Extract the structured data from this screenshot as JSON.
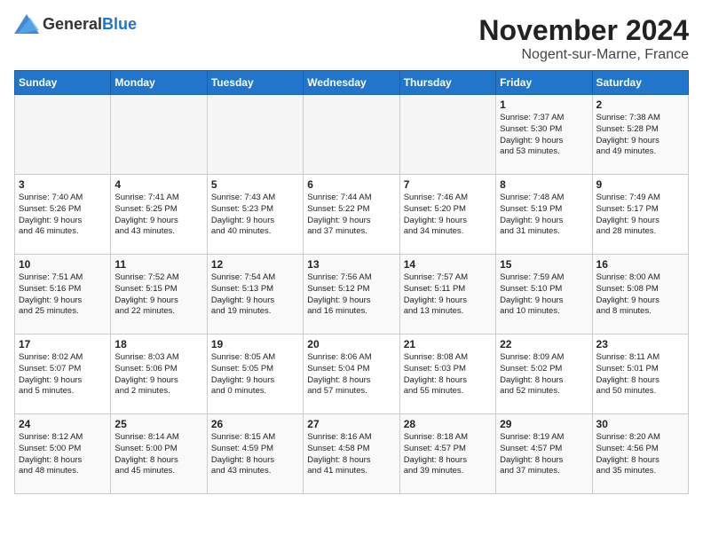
{
  "logo": {
    "text_general": "General",
    "text_blue": "Blue"
  },
  "title": {
    "month": "November 2024",
    "location": "Nogent-sur-Marne, France"
  },
  "headers": [
    "Sunday",
    "Monday",
    "Tuesday",
    "Wednesday",
    "Thursday",
    "Friday",
    "Saturday"
  ],
  "weeks": [
    [
      {
        "day": "",
        "info": ""
      },
      {
        "day": "",
        "info": ""
      },
      {
        "day": "",
        "info": ""
      },
      {
        "day": "",
        "info": ""
      },
      {
        "day": "",
        "info": ""
      },
      {
        "day": "1",
        "info": "Sunrise: 7:37 AM\nSunset: 5:30 PM\nDaylight: 9 hours\nand 53 minutes."
      },
      {
        "day": "2",
        "info": "Sunrise: 7:38 AM\nSunset: 5:28 PM\nDaylight: 9 hours\nand 49 minutes."
      }
    ],
    [
      {
        "day": "3",
        "info": "Sunrise: 7:40 AM\nSunset: 5:26 PM\nDaylight: 9 hours\nand 46 minutes."
      },
      {
        "day": "4",
        "info": "Sunrise: 7:41 AM\nSunset: 5:25 PM\nDaylight: 9 hours\nand 43 minutes."
      },
      {
        "day": "5",
        "info": "Sunrise: 7:43 AM\nSunset: 5:23 PM\nDaylight: 9 hours\nand 40 minutes."
      },
      {
        "day": "6",
        "info": "Sunrise: 7:44 AM\nSunset: 5:22 PM\nDaylight: 9 hours\nand 37 minutes."
      },
      {
        "day": "7",
        "info": "Sunrise: 7:46 AM\nSunset: 5:20 PM\nDaylight: 9 hours\nand 34 minutes."
      },
      {
        "day": "8",
        "info": "Sunrise: 7:48 AM\nSunset: 5:19 PM\nDaylight: 9 hours\nand 31 minutes."
      },
      {
        "day": "9",
        "info": "Sunrise: 7:49 AM\nSunset: 5:17 PM\nDaylight: 9 hours\nand 28 minutes."
      }
    ],
    [
      {
        "day": "10",
        "info": "Sunrise: 7:51 AM\nSunset: 5:16 PM\nDaylight: 9 hours\nand 25 minutes."
      },
      {
        "day": "11",
        "info": "Sunrise: 7:52 AM\nSunset: 5:15 PM\nDaylight: 9 hours\nand 22 minutes."
      },
      {
        "day": "12",
        "info": "Sunrise: 7:54 AM\nSunset: 5:13 PM\nDaylight: 9 hours\nand 19 minutes."
      },
      {
        "day": "13",
        "info": "Sunrise: 7:56 AM\nSunset: 5:12 PM\nDaylight: 9 hours\nand 16 minutes."
      },
      {
        "day": "14",
        "info": "Sunrise: 7:57 AM\nSunset: 5:11 PM\nDaylight: 9 hours\nand 13 minutes."
      },
      {
        "day": "15",
        "info": "Sunrise: 7:59 AM\nSunset: 5:10 PM\nDaylight: 9 hours\nand 10 minutes."
      },
      {
        "day": "16",
        "info": "Sunrise: 8:00 AM\nSunset: 5:08 PM\nDaylight: 9 hours\nand 8 minutes."
      }
    ],
    [
      {
        "day": "17",
        "info": "Sunrise: 8:02 AM\nSunset: 5:07 PM\nDaylight: 9 hours\nand 5 minutes."
      },
      {
        "day": "18",
        "info": "Sunrise: 8:03 AM\nSunset: 5:06 PM\nDaylight: 9 hours\nand 2 minutes."
      },
      {
        "day": "19",
        "info": "Sunrise: 8:05 AM\nSunset: 5:05 PM\nDaylight: 9 hours\nand 0 minutes."
      },
      {
        "day": "20",
        "info": "Sunrise: 8:06 AM\nSunset: 5:04 PM\nDaylight: 8 hours\nand 57 minutes."
      },
      {
        "day": "21",
        "info": "Sunrise: 8:08 AM\nSunset: 5:03 PM\nDaylight: 8 hours\nand 55 minutes."
      },
      {
        "day": "22",
        "info": "Sunrise: 8:09 AM\nSunset: 5:02 PM\nDaylight: 8 hours\nand 52 minutes."
      },
      {
        "day": "23",
        "info": "Sunrise: 8:11 AM\nSunset: 5:01 PM\nDaylight: 8 hours\nand 50 minutes."
      }
    ],
    [
      {
        "day": "24",
        "info": "Sunrise: 8:12 AM\nSunset: 5:00 PM\nDaylight: 8 hours\nand 48 minutes."
      },
      {
        "day": "25",
        "info": "Sunrise: 8:14 AM\nSunset: 5:00 PM\nDaylight: 8 hours\nand 45 minutes."
      },
      {
        "day": "26",
        "info": "Sunrise: 8:15 AM\nSunset: 4:59 PM\nDaylight: 8 hours\nand 43 minutes."
      },
      {
        "day": "27",
        "info": "Sunrise: 8:16 AM\nSunset: 4:58 PM\nDaylight: 8 hours\nand 41 minutes."
      },
      {
        "day": "28",
        "info": "Sunrise: 8:18 AM\nSunset: 4:57 PM\nDaylight: 8 hours\nand 39 minutes."
      },
      {
        "day": "29",
        "info": "Sunrise: 8:19 AM\nSunset: 4:57 PM\nDaylight: 8 hours\nand 37 minutes."
      },
      {
        "day": "30",
        "info": "Sunrise: 8:20 AM\nSunset: 4:56 PM\nDaylight: 8 hours\nand 35 minutes."
      }
    ]
  ]
}
